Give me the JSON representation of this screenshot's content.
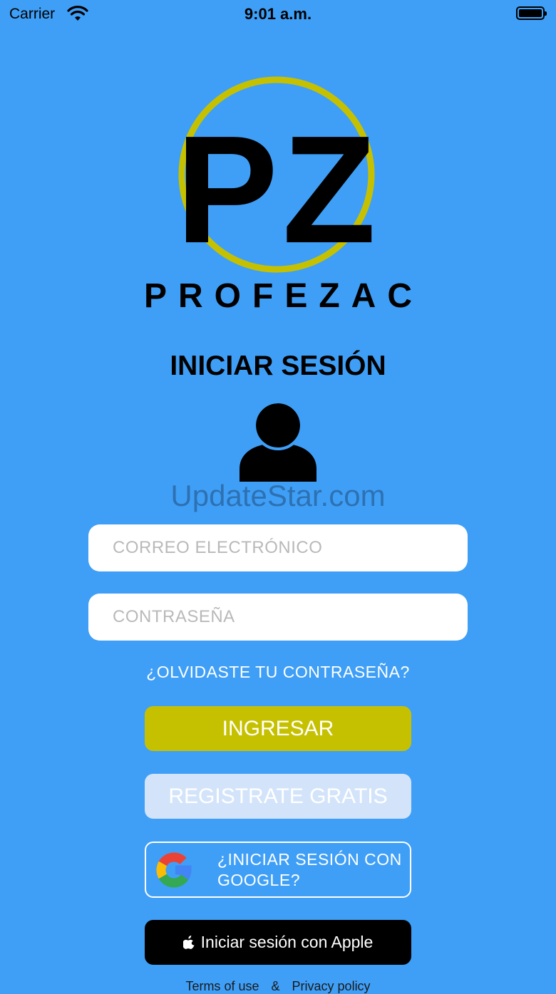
{
  "status_bar": {
    "carrier": "Carrier",
    "time": "9:01 a.m."
  },
  "logo": {
    "monogram": "PZ",
    "brand": "PROFEZAC",
    "ring_color": "#c6c100"
  },
  "login": {
    "title": "INICIAR SESIÓN",
    "watermark": "UpdateStar.com",
    "email_placeholder": "CORREO ELECTRÓNICO",
    "password_placeholder": "CONTRASEÑA",
    "forgot_label": "¿OLVIDASTE TU CONTRASEÑA?",
    "login_label": "INGRESAR",
    "register_label": "REGISTRATE GRATIS",
    "google_label": "¿INICIAR SESIÓN CON GOOGLE?",
    "apple_label": "Iniciar sesión con Apple"
  },
  "footer": {
    "terms": "Terms of use",
    "separator": "&",
    "privacy": "Privacy policy"
  },
  "colors": {
    "background": "#3f9ff7",
    "accent": "#c6c100",
    "register_bg": "#d3e4fa"
  }
}
